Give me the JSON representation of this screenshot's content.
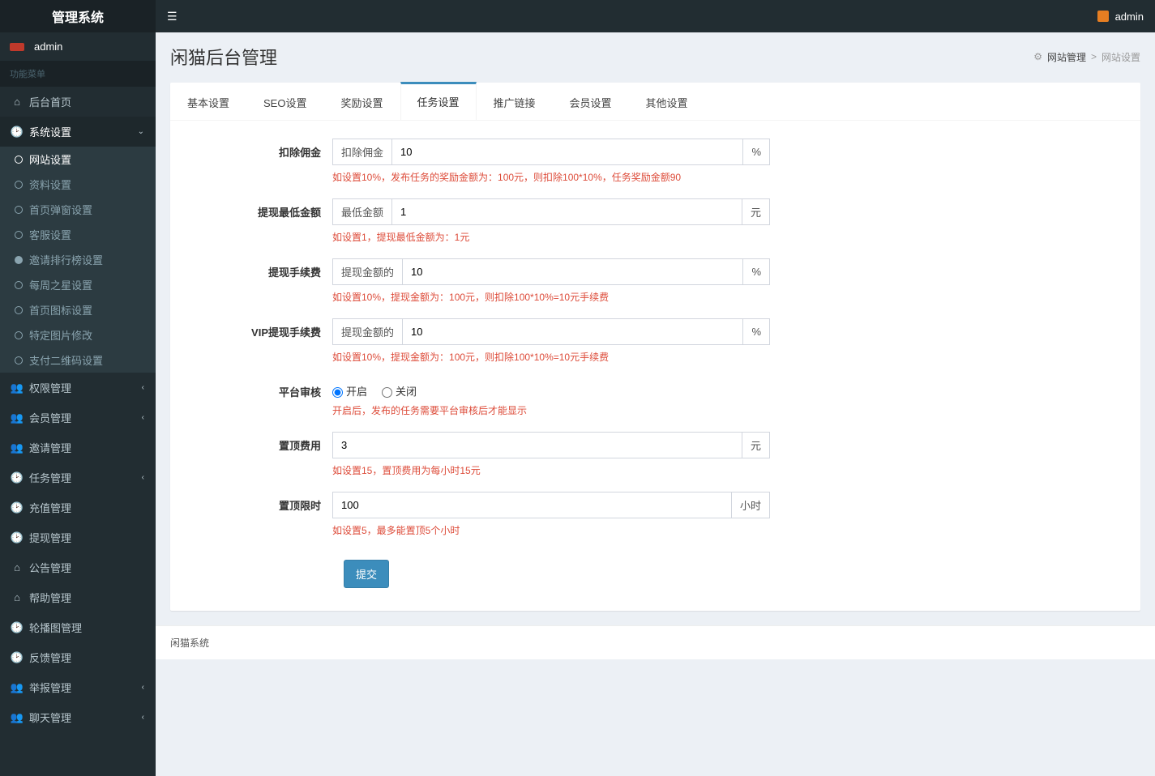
{
  "app_name": "管理系统",
  "top_user": "admin",
  "sidebar": {
    "user_name": "admin",
    "menu_header": "功能菜单",
    "items": [
      {
        "label": "后台首页",
        "icon": "home"
      },
      {
        "label": "系统设置",
        "icon": "dashboard",
        "open": true,
        "children": [
          {
            "label": "网站设置",
            "active": true
          },
          {
            "label": "资料设置"
          },
          {
            "label": "首页弹窗设置"
          },
          {
            "label": "客服设置"
          },
          {
            "label": "邀请排行榜设置",
            "filled": true
          },
          {
            "label": "每周之星设置"
          },
          {
            "label": "首页图标设置"
          },
          {
            "label": "特定图片修改"
          },
          {
            "label": "支付二维码设置"
          }
        ]
      },
      {
        "label": "权限管理",
        "icon": "users",
        "chev": true
      },
      {
        "label": "会员管理",
        "icon": "users",
        "chev": true
      },
      {
        "label": "邀请管理",
        "icon": "users"
      },
      {
        "label": "任务管理",
        "icon": "dashboard",
        "chev": true
      },
      {
        "label": "充值管理",
        "icon": "dashboard"
      },
      {
        "label": "提现管理",
        "icon": "dashboard"
      },
      {
        "label": "公告管理",
        "icon": "home"
      },
      {
        "label": "帮助管理",
        "icon": "home"
      },
      {
        "label": "轮播图管理",
        "icon": "dashboard"
      },
      {
        "label": "反馈管理",
        "icon": "dashboard"
      },
      {
        "label": "举报管理",
        "icon": "users",
        "chev": true
      },
      {
        "label": "聊天管理",
        "icon": "users",
        "chev": true
      }
    ]
  },
  "page": {
    "title": "闲猫后台管理",
    "breadcrumb_root": "网站管理",
    "breadcrumb_current": "网站设置"
  },
  "tabs": [
    "基本设置",
    "SEO设置",
    "奖励设置",
    "任务设置",
    "推广链接",
    "会员设置",
    "其他设置"
  ],
  "active_tab": 3,
  "form": {
    "rows": [
      {
        "label": "扣除佣金",
        "prefix": "扣除佣金",
        "value": "10",
        "suffix": "%",
        "help": "如设置10%，发布任务的奖励金额为：100元，则扣除100*10%，任务奖励金额90"
      },
      {
        "label": "提现最低金额",
        "prefix": "最低金额",
        "value": "1",
        "suffix": "元",
        "help": "如设置1，提现最低金额为：1元"
      },
      {
        "label": "提现手续费",
        "prefix": "提现金额的",
        "value": "10",
        "suffix": "%",
        "help": "如设置10%，提现金额为：100元，则扣除100*10%=10元手续费"
      },
      {
        "label": "VIP提现手续费",
        "prefix": "提现金额的",
        "value": "10",
        "suffix": "%",
        "help": "如设置10%，提现金额为：100元，则扣除100*10%=10元手续费"
      },
      {
        "label": "平台审核",
        "type": "radio",
        "options": [
          "开启",
          "关闭"
        ],
        "selected": 0,
        "help": "开启后，发布的任务需要平台审核后才能显示"
      },
      {
        "label": "置顶费用",
        "value": "3",
        "suffix": "元",
        "help": "如设置15，置顶费用为每小时15元"
      },
      {
        "label": "置顶限时",
        "value": "100",
        "suffix": "小时",
        "help": "如设置5，最多能置顶5个小时"
      }
    ],
    "submit_label": "提交"
  },
  "footer": "闲猫系统"
}
